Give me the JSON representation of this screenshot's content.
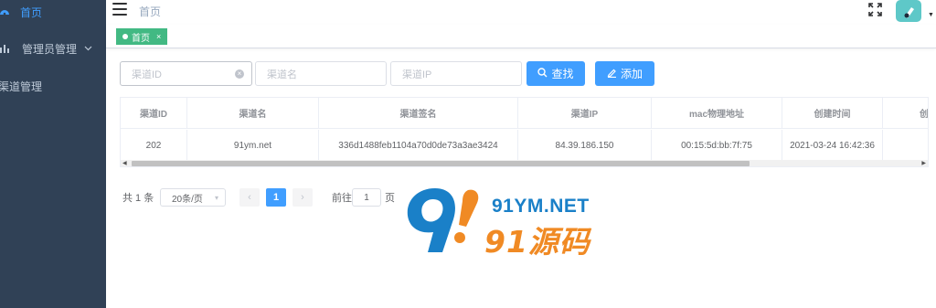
{
  "sidebar": {
    "items": [
      {
        "label": "首页",
        "icon": "dashboard-icon"
      },
      {
        "label": "管理员管理",
        "icon": "bar-chart-icon"
      },
      {
        "label": "渠道管理",
        "icon": ""
      }
    ]
  },
  "navbar": {
    "breadcrumb": "首页"
  },
  "tags": [
    {
      "label": "首页",
      "close": "×"
    }
  ],
  "filters": {
    "channel_id_placeholder": "渠道ID",
    "channel_name_placeholder": "渠道名",
    "channel_ip_placeholder": "渠道IP",
    "search_label": "查找",
    "add_label": "添加"
  },
  "table": {
    "columns": [
      "渠道ID",
      "渠道名",
      "渠道签名",
      "渠道IP",
      "mac物理地址",
      "创建时间",
      "创"
    ],
    "rows": [
      [
        "202",
        "91ym.net",
        "336d1488feb1104a70d0de73a3ae3424",
        "84.39.186.150",
        "00:15:5d:bb:7f:75",
        "2021-03-24 16:42:36",
        ""
      ]
    ]
  },
  "pagination": {
    "total": "共 1 条",
    "page_size": "20条/页",
    "prev": "‹",
    "current": "1",
    "next": "›",
    "goto_prefix": "前往",
    "goto_value": "1",
    "goto_suffix": "页"
  },
  "watermark": {
    "text_en": "91YM.NET",
    "text_cn": "91源码"
  },
  "colors": {
    "sidebar_bg": "#304156",
    "sidebar_active": "#409eff",
    "primary": "#409eff",
    "tag_green": "#42b983"
  }
}
